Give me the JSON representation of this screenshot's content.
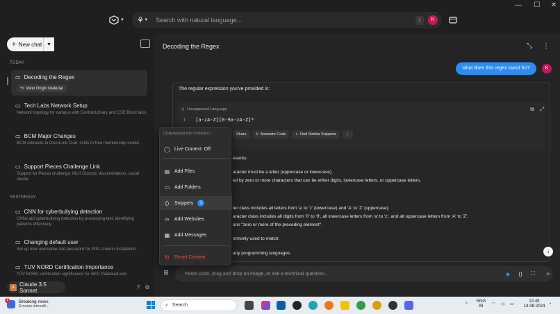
{
  "window": {
    "minimize": "—",
    "maximize": "☐",
    "close": "✕"
  },
  "topbar": {
    "search_placeholder": "Search with natural language...",
    "shortcut": "/",
    "user_initial": "K"
  },
  "sidebar": {
    "new_chat": "New chat",
    "sections": {
      "today": "TODAY",
      "yesterday": "YESTERDAY"
    },
    "chats": [
      {
        "title": "Decoding the Regex",
        "subtitle": "",
        "action": "View Origin Material"
      },
      {
        "title": "Tech Labs Network Setup",
        "subtitle": "Network topology for campus with Central Library and CSE Block labs."
      },
      {
        "title": "BCM Major Changes",
        "subtitle": "BCM rebrands to DiscoLink Club, shifts to free membership model."
      },
      {
        "title": "Support Pieces Challenge Link",
        "subtitle": "Support for Pieces challenge: MLH Discord, documentation, social media."
      },
      {
        "title": "CNN for cyberbullying detection",
        "subtitle": "CNNs aid cyberbullying detection by processing text, identifying patterns effectively."
      },
      {
        "title": "Changing default user",
        "subtitle": "Set up new username and password for WSL Ubuntu installation."
      },
      {
        "title": "TUV NORD Certification Importance",
        "subtitle": "TÜV NORD certification significance for GEC Palakkad and"
      }
    ],
    "model": "Claude 3.5 Sonnet"
  },
  "main": {
    "title": "Decoding the Regex",
    "user_message": "what does this regex stand for?",
    "user_initial": "K",
    "answer_intro": "The regular expression you've provided is:",
    "code": {
      "language": "Unsupported Language",
      "line_number": "1",
      "text": "[a-zA-Z][0-9a-zA-Z]*",
      "buttons": [
        "Share",
        "Annotate Code",
        "Find Similar Snippets"
      ]
    },
    "answer_lines": [
      "esents:",
      "aracter must be a letter (uppercase or lowercase).",
      "ed by zero or more characters that can be either digits, lowercase letters, or uppercase letters.",
      "",
      "ter class includes all letters from 'a' to 'z' (lowercase) and 'A' to 'Z' (uppercase).",
      "aracter class includes all digits from '0' to '9', all lowercase letters from 'a' to 'z', and all uppercase letters from 'A' to 'Z'.",
      "ans \"zero or more of the preceding element\".",
      "mmonly used to match:",
      "any programming languages"
    ],
    "input_placeholder": "Paste code, drag and drop an image, or ask a technical question..."
  },
  "context_menu": {
    "header": "CONVERSATION CONTEXT",
    "live_context": "Live Context: Off",
    "items": [
      "Add Files",
      "Add Folders",
      "Snippets",
      "Add Websites",
      "Add Messages"
    ],
    "snippets_count": "1",
    "reset": "Reset Context"
  },
  "taskbar": {
    "news_title": "Breaking news",
    "news_sub": "Ernesto intensifi...",
    "news_badge": "1",
    "search": "Search",
    "lang_1": "ENG",
    "lang_2": "IN",
    "time": "22:49",
    "date": "14-08-2024"
  }
}
